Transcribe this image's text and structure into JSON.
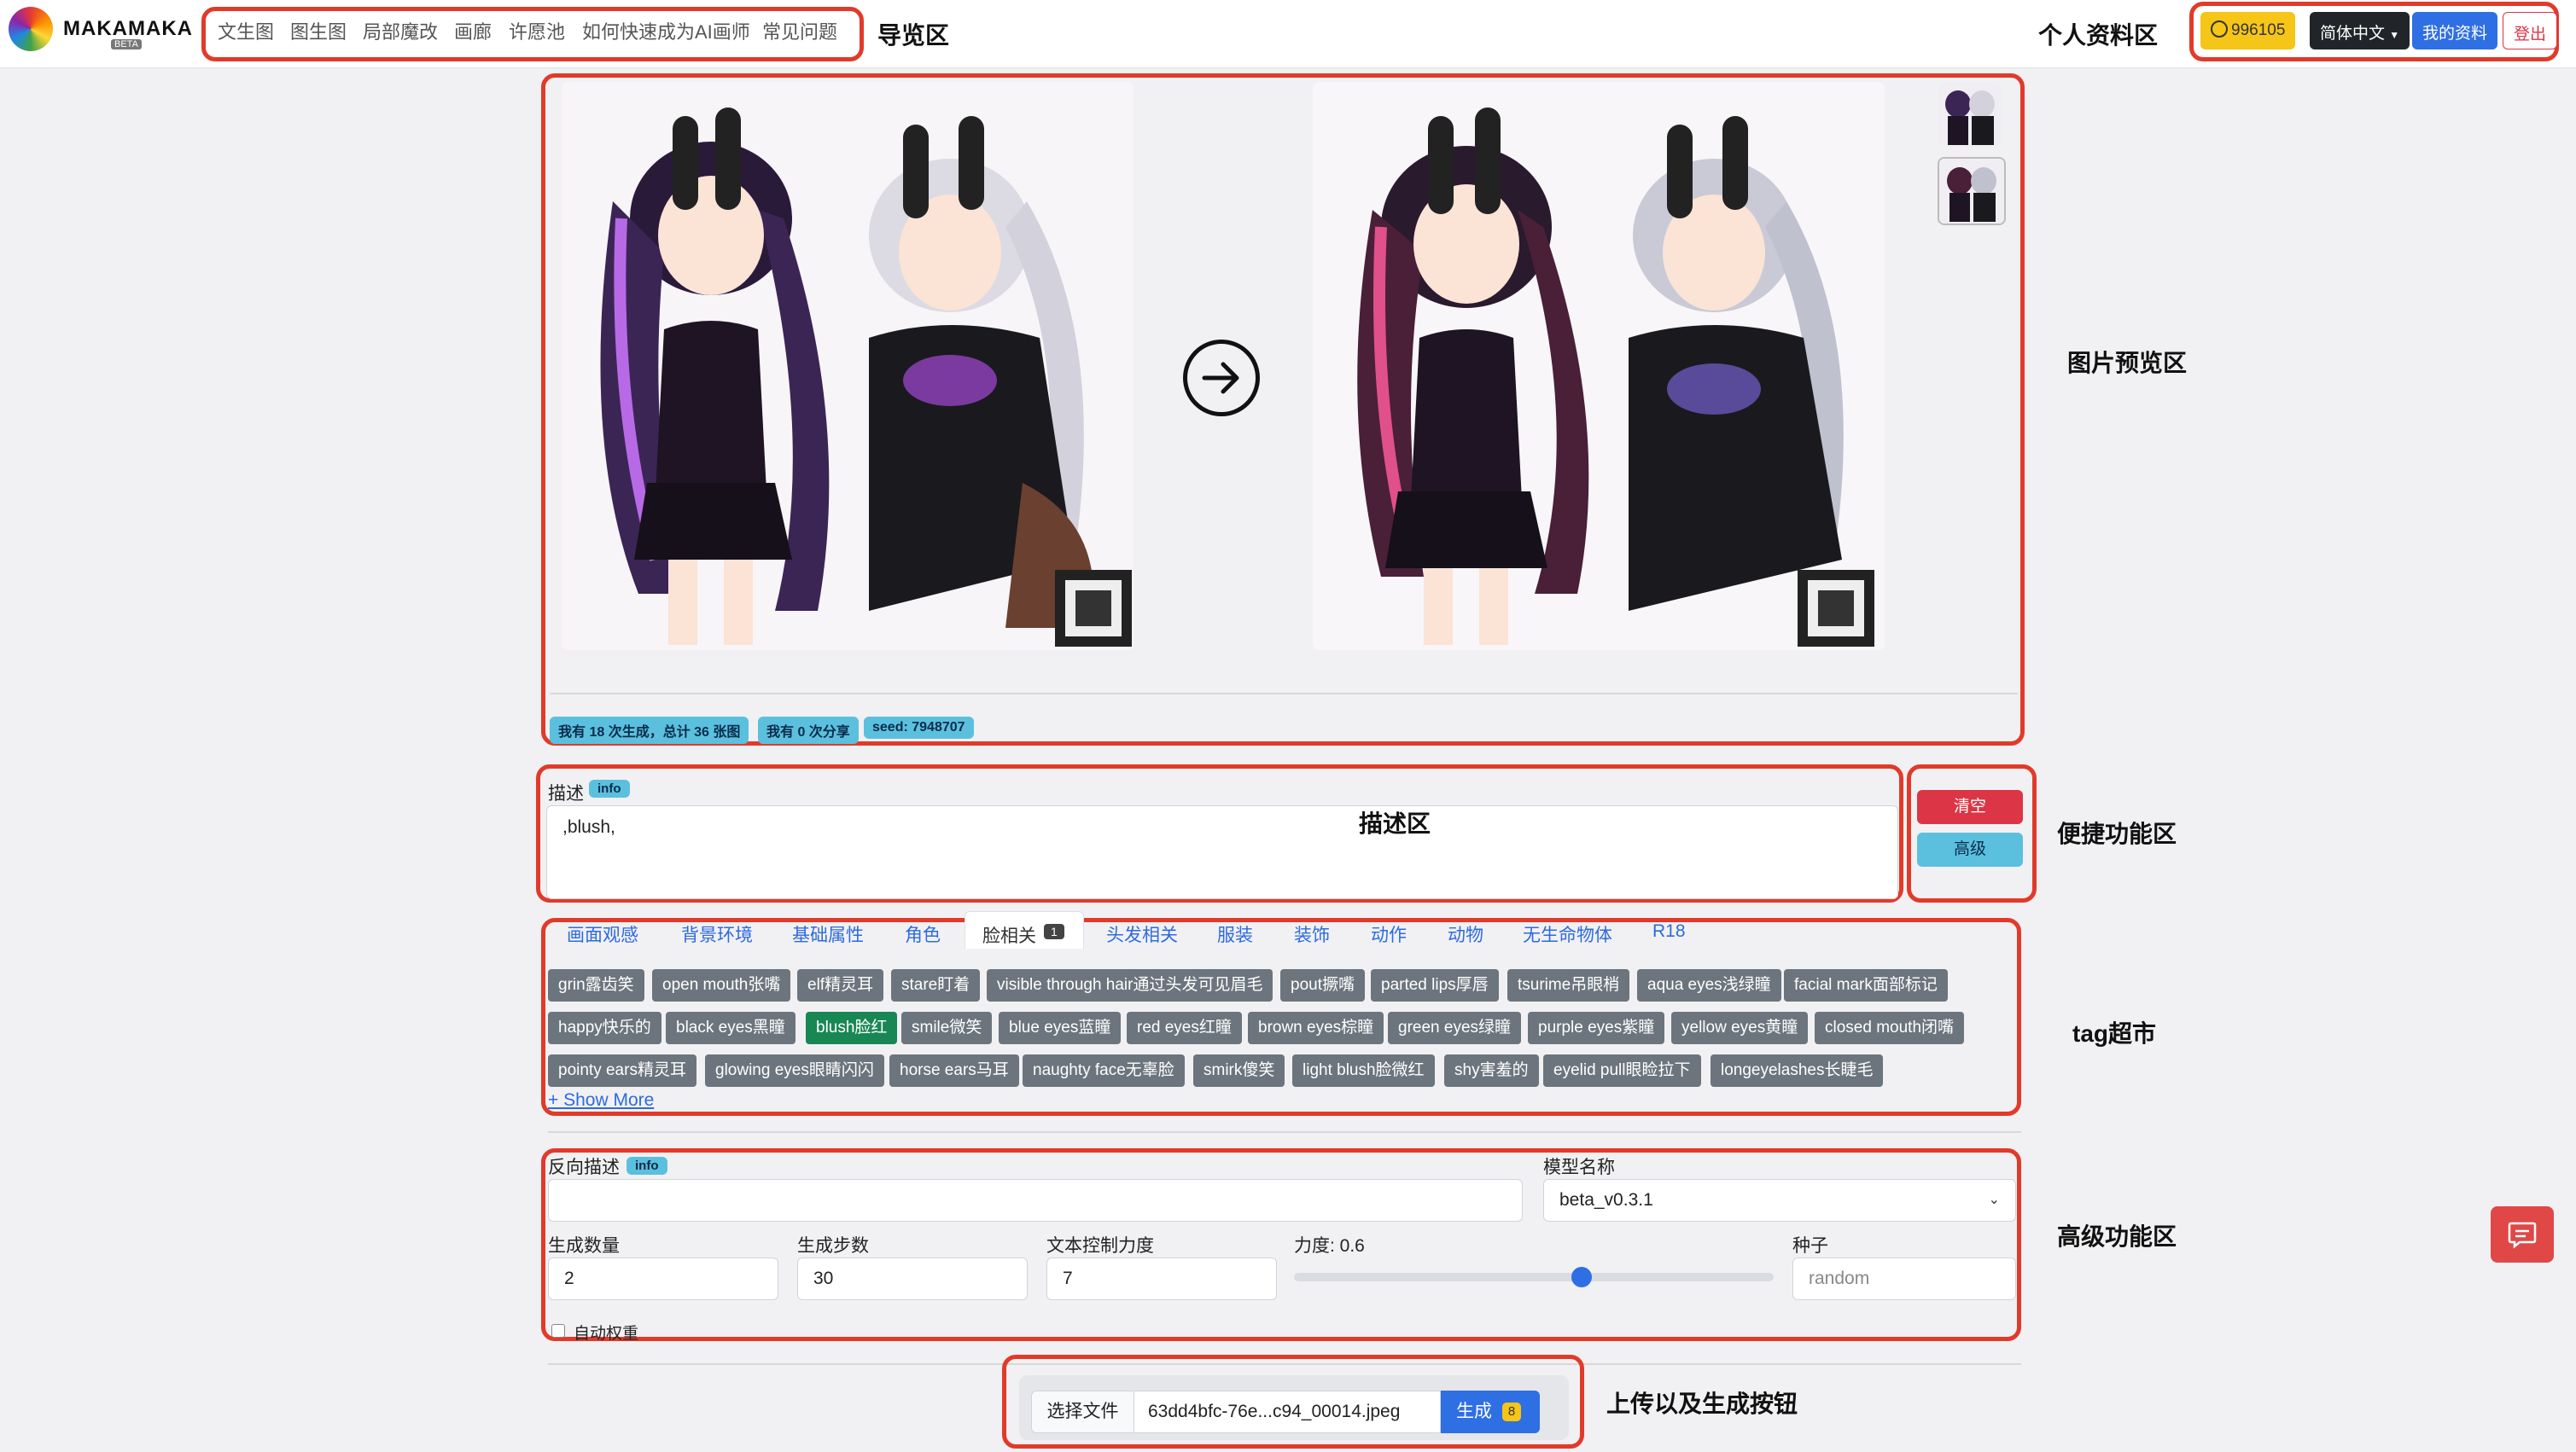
{
  "nav": {
    "brand": "MAKAMAKA",
    "brand_badge": "BETA",
    "items": [
      "文生图",
      "图生图",
      "局部魔改",
      "画廊",
      "许愿池",
      "如何快速成为AI画师",
      "常见问题"
    ]
  },
  "user": {
    "coins": "996105",
    "language": "简体中文",
    "profile_label": "我的资料",
    "logout_label": "登出"
  },
  "annotations": {
    "nav": "导览区",
    "profile": "个人资料区",
    "preview": "图片预览区",
    "prompt": "描述区",
    "quick": "便捷功能区",
    "tags": "tag超市",
    "advanced": "高级功能区",
    "upload": "上传以及生成按钮"
  },
  "preview": {
    "stats": [
      "我有 18 次生成，总计 36 张图",
      "我有 0 次分享",
      "seed: 7948707"
    ]
  },
  "prompt": {
    "label": "描述",
    "info_badge": "info",
    "value": ",blush,"
  },
  "quick": {
    "clear_label": "清空",
    "advanced_label": "高级"
  },
  "tag_categories": [
    "画面观感",
    "背景环境",
    "基础属性",
    "角色",
    "脸相关",
    "头发相关",
    "服装",
    "装饰",
    "动作",
    "动物",
    "无生命物体",
    "R18"
  ],
  "active_category": "脸相关",
  "active_category_count": "1",
  "tags": [
    "grin露齿笑",
    "open mouth张嘴",
    "elf精灵耳",
    "stare盯着",
    "visible through hair通过头发可见眉毛",
    "pout撅嘴",
    "parted lips厚唇",
    "tsurime吊眼梢",
    "aqua eyes浅绿瞳",
    "facial mark面部标记",
    "happy快乐的",
    "black eyes黑瞳",
    "blush脸红",
    "smile微笑",
    "blue eyes蓝瞳",
    "red eyes红瞳",
    "brown eyes棕瞳",
    "green eyes绿瞳",
    "purple eyes紫瞳",
    "yellow eyes黄瞳",
    "closed mouth闭嘴",
    "pointy ears精灵耳",
    "glowing eyes眼睛闪闪",
    "horse ears马耳",
    "naughty face无辜脸",
    "smirk傻笑",
    "light blush脸微红",
    "shy害羞的",
    "eyelid pull眼睑拉下",
    "longeyelashes长睫毛"
  ],
  "selected_tag": "blush脸红",
  "show_more_label": "+ Show More",
  "advanced": {
    "negative_label": "反向描述",
    "info_badge": "info",
    "model_label": "模型名称",
    "model_value": "beta_v0.3.1",
    "count_label": "生成数量",
    "count_value": "2",
    "steps_label": "生成步数",
    "steps_value": "30",
    "cfg_label": "文本控制力度",
    "cfg_value": "7",
    "strength_label": "力度: 0.6",
    "strength_value": 0.6,
    "seed_label": "种子",
    "seed_placeholder": "random",
    "auto_weight_label": "自动权重"
  },
  "upload": {
    "choose_label": "选择文件",
    "file_name": "63dd4bfc-76e...c94_00014.jpeg",
    "generate_label": "生成",
    "generate_count": "8"
  },
  "colors": {
    "annotation_red": "#e23a2a",
    "coin_yellow": "#f5c518",
    "primary_blue": "#2f6fe4",
    "danger_red": "#dc3545",
    "info_sky": "#5bc0de",
    "selected_green": "#198754",
    "tag_gray": "#6c757d"
  }
}
